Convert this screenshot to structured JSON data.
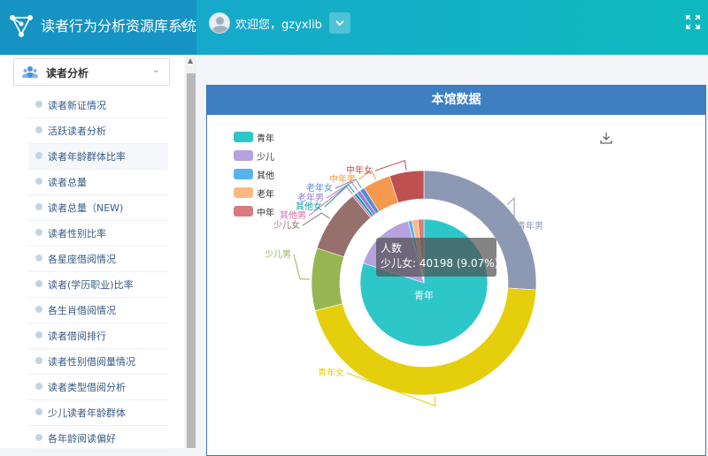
{
  "app": {
    "title": "读者行为分析资源库系统"
  },
  "header": {
    "welcome": "欢迎您，gzyxlib"
  },
  "sidebar": {
    "group_label": "读者分析",
    "items": [
      "读者新证情况",
      "活跃读者分析",
      "读者年龄群体比率",
      "读者总量",
      "读者总量（NEW)",
      "读者性别比率",
      "各星座借阅情况",
      "读者(学历职业)比率",
      "各生肖借阅情况",
      "读者借阅排行",
      "读者性别借阅量情况",
      "读者类型借阅分析",
      "少儿读者年龄群体",
      "各年龄阅读偏好"
    ],
    "active_index": 2
  },
  "panel": {
    "title": "本馆数据"
  },
  "legend": [
    {
      "label": "青年",
      "color": "#2ec7c9"
    },
    {
      "label": "少儿",
      "color": "#b6a2de"
    },
    {
      "label": "其他",
      "color": "#5ab1ef"
    },
    {
      "label": "老年",
      "color": "#ffb980"
    },
    {
      "label": "中年",
      "color": "#d87a80"
    }
  ],
  "chart_data": {
    "type": "pie",
    "inner": {
      "slices": [
        {
          "label": "青年",
          "value": 0.8,
          "color": "#2ec7c9"
        },
        {
          "label": "少儿",
          "value": 0.16,
          "color": "#b6a2de"
        },
        {
          "label": "其他",
          "value": 0.01,
          "color": "#5ab1ef"
        },
        {
          "label": "老年",
          "value": 0.015,
          "color": "#ffb980"
        },
        {
          "label": "中年",
          "value": 0.015,
          "color": "#d87a80"
        }
      ]
    },
    "outer": {
      "slices": [
        {
          "label": "青年男",
          "value": 0.26,
          "color": "#8d98b3"
        },
        {
          "label": "青年女",
          "value": 0.45,
          "color": "#e5cf0d"
        },
        {
          "label": "少儿男",
          "value": 0.09,
          "color": "#97b552"
        },
        {
          "label": "少儿女",
          "value": 0.0907,
          "color": "#95706d"
        },
        {
          "label": "其他男",
          "value": 0.003,
          "color": "#dc69aa"
        },
        {
          "label": "其他女",
          "value": 0.004,
          "color": "#07a2a4"
        },
        {
          "label": "老年男",
          "value": 0.006,
          "color": "#9a7fd1"
        },
        {
          "label": "老年女",
          "value": 0.007,
          "color": "#588dd5"
        },
        {
          "label": "中年男",
          "value": 0.04,
          "color": "#f5994e"
        },
        {
          "label": "中年女",
          "value": 0.0493,
          "color": "#c05050"
        }
      ]
    }
  },
  "tooltip": {
    "series": "人数",
    "line": "少儿女: 40198 (9.07%)"
  }
}
